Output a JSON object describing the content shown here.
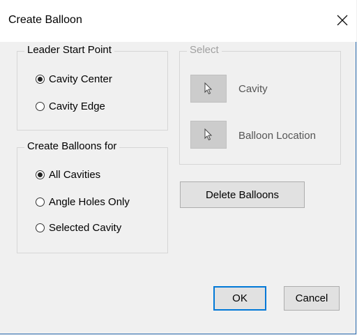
{
  "window": {
    "title": "Create Balloon"
  },
  "leader_group": {
    "legend": "Leader Start Point",
    "options": [
      {
        "label": "Cavity Center",
        "selected": true
      },
      {
        "label": "Cavity Edge",
        "selected": false
      }
    ]
  },
  "balloons_group": {
    "legend": "Create Balloons for",
    "options": [
      {
        "label": "All Cavities",
        "selected": true
      },
      {
        "label": "Angle Holes Only",
        "selected": false
      },
      {
        "label": "Selected Cavity",
        "selected": false
      }
    ]
  },
  "select_group": {
    "legend": "Select",
    "cavity_label": "Cavity",
    "balloon_location_label": "Balloon Location"
  },
  "buttons": {
    "delete_balloons": "Delete Balloons",
    "ok": "OK",
    "cancel": "Cancel"
  },
  "icons": {
    "close": "close-icon",
    "cursor": "cursor-arrow-icon"
  },
  "colors": {
    "dialog_background": "#f0f0f0",
    "title_background": "#ffffff",
    "default_button_border": "#0078d7",
    "window_border": "#2b6cb0",
    "pick_button": "#cccccc"
  }
}
